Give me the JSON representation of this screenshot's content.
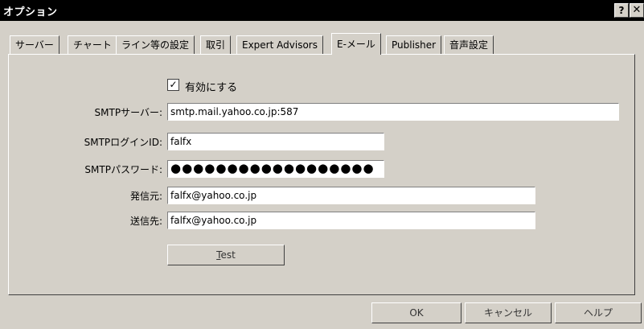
{
  "window": {
    "title": "オプション",
    "help_label": "?",
    "close_label": "✕"
  },
  "tabs": [
    {
      "label": "サーバー"
    },
    {
      "label": "チャート"
    },
    {
      "label": "ライン等の設定"
    },
    {
      "label": "取引"
    },
    {
      "label": "Expert Advisors"
    },
    {
      "label": "E-メール",
      "active": true
    },
    {
      "label": "Publisher"
    },
    {
      "label": "音声設定"
    }
  ],
  "email": {
    "enable_checked": true,
    "checkmark": "✓",
    "enable_label": "有効にする",
    "smtp_server_label": "SMTPサーバー:",
    "smtp_server_value": "smtp.mail.yahoo.co.jp:587",
    "login_label": "SMTPログインID:",
    "login_value": "falfx",
    "password_label": "SMTPパスワード:",
    "password_value": "●●●●●●●●●●●●●●●●●●",
    "from_label": "発信元:",
    "from_value": "falfx@yahoo.co.jp",
    "to_label": "送信先:",
    "to_value": "falfx@yahoo.co.jp",
    "test_hotkey": "T",
    "test_rest": "est"
  },
  "buttons": {
    "ok": "OK",
    "cancel": "キャンセル",
    "help": "ヘルプ"
  }
}
